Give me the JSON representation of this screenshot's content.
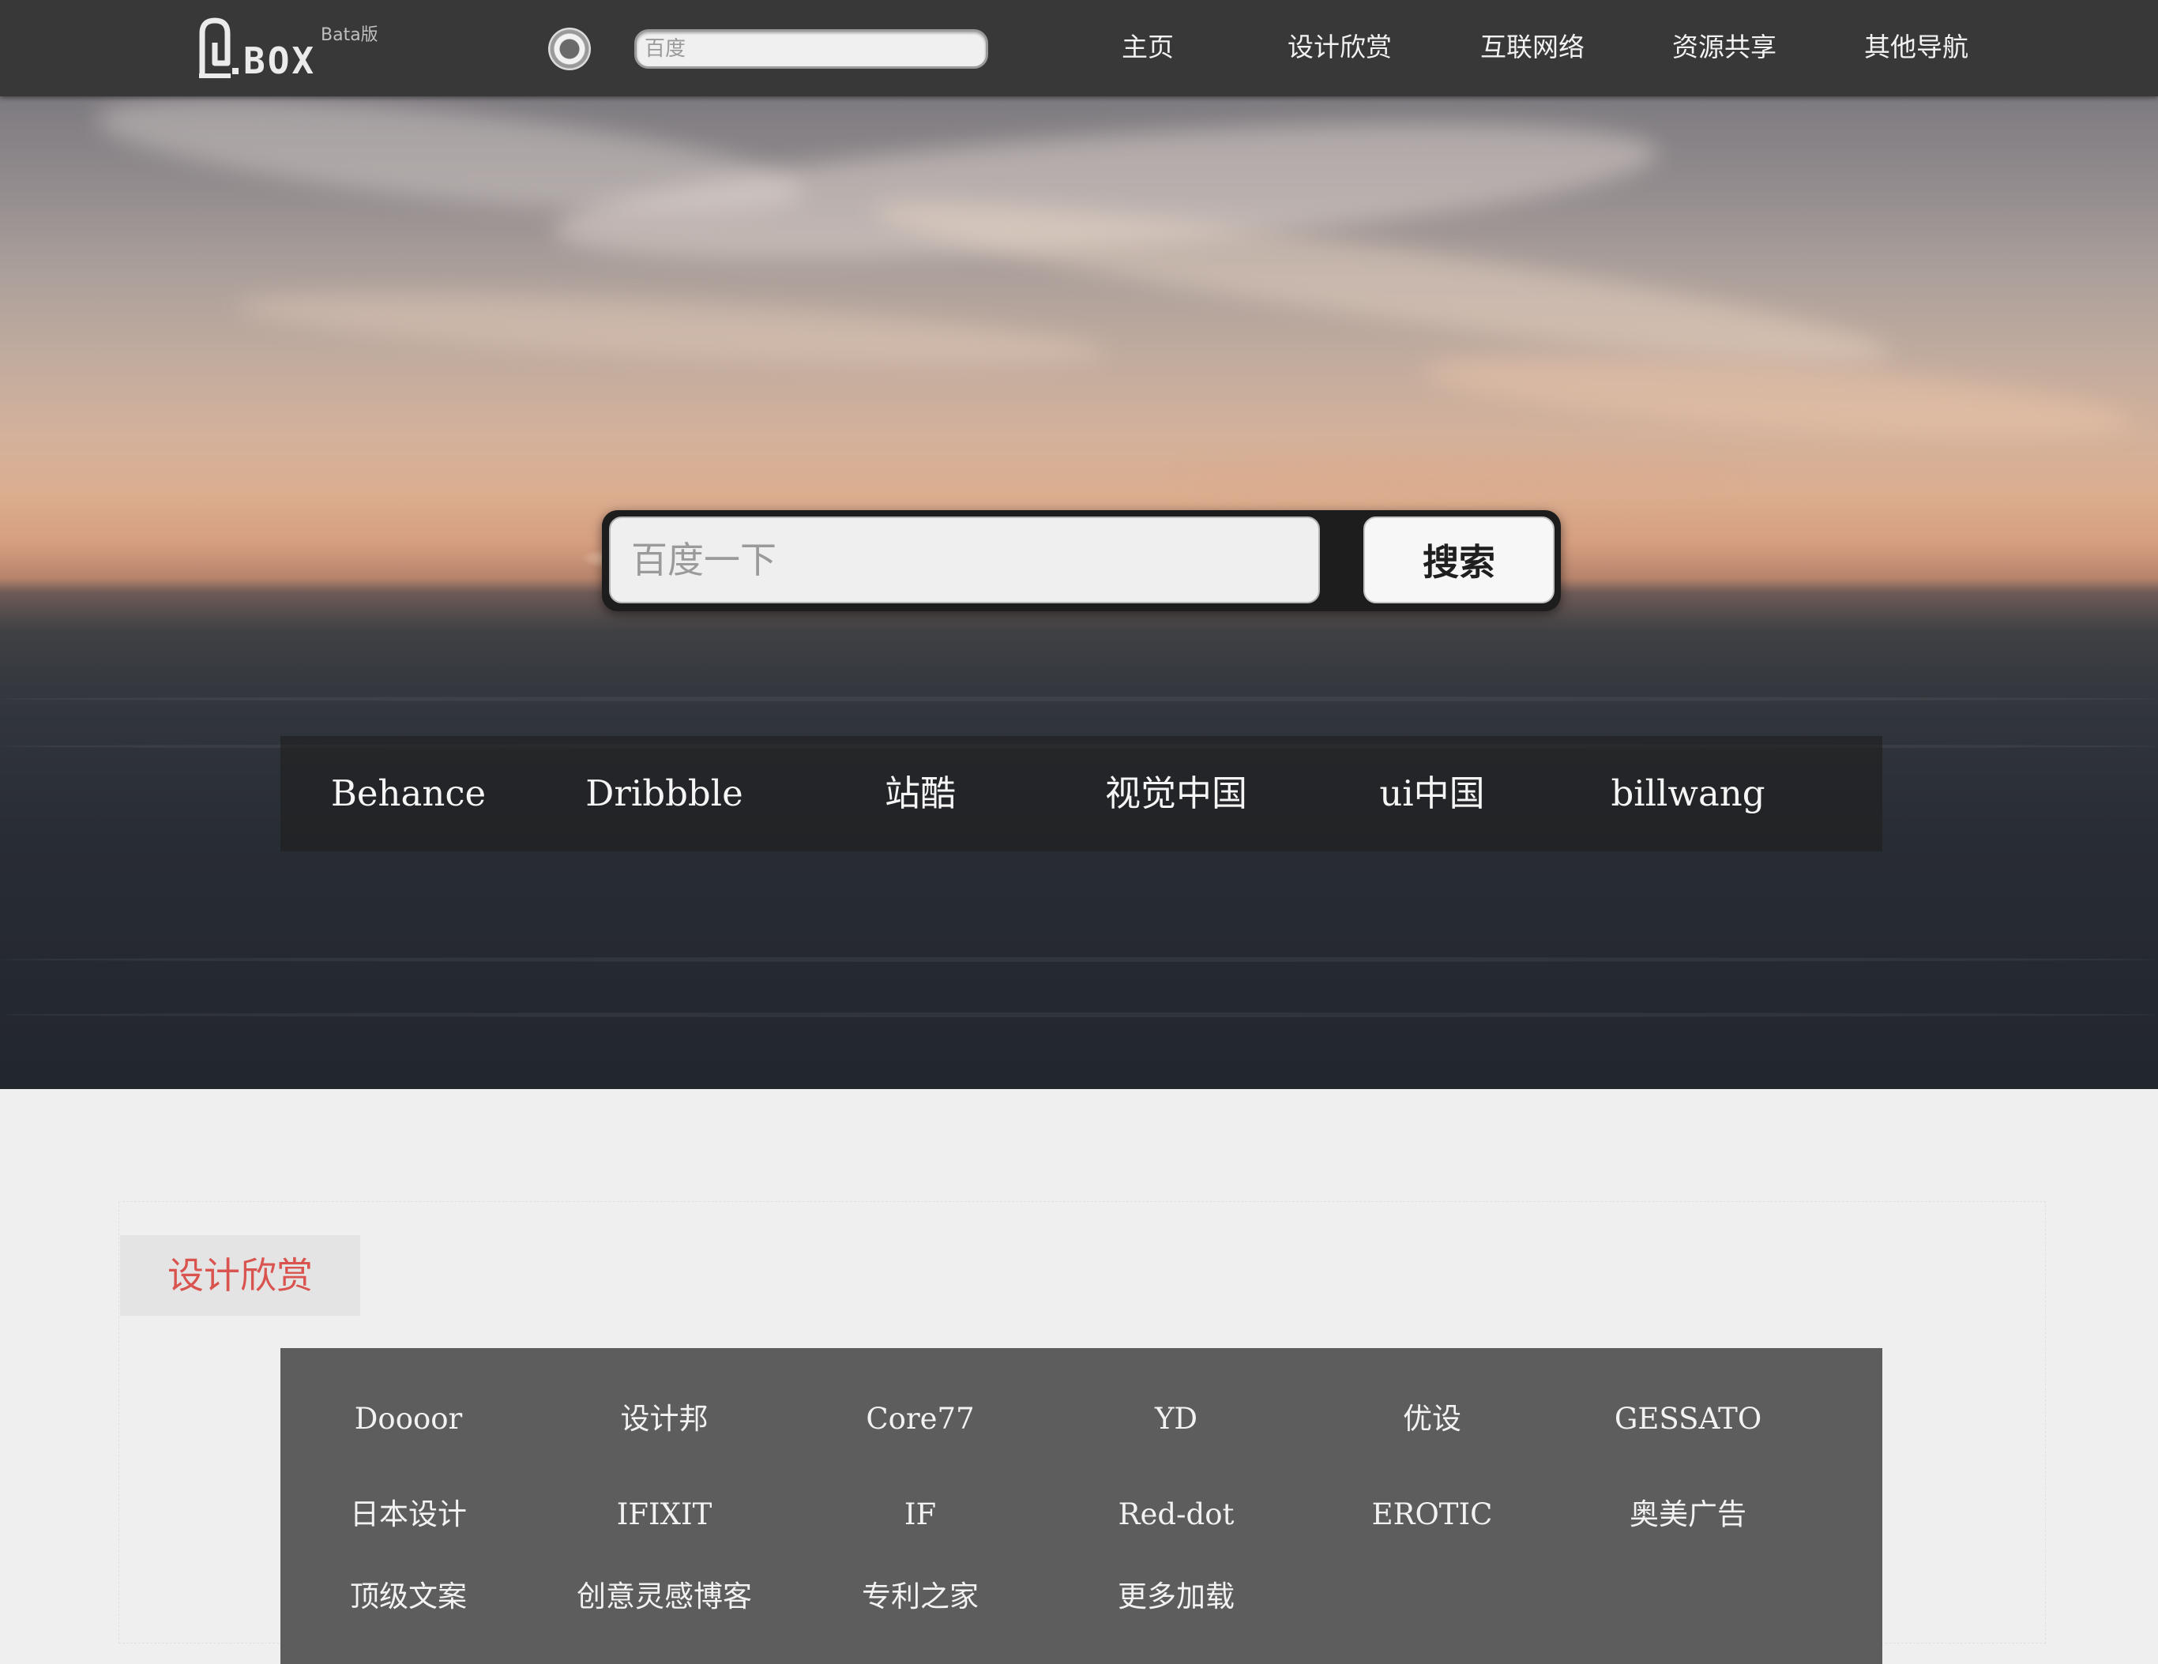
{
  "header": {
    "logo_text": "BOX",
    "logo_beta": "Bata版",
    "engine_icon": "radio-circle-icon",
    "search_placeholder": "百度",
    "nav": [
      {
        "label": "主页"
      },
      {
        "label": "设计欣赏"
      },
      {
        "label": "互联网络"
      },
      {
        "label": "资源共享"
      },
      {
        "label": "其他导航"
      }
    ]
  },
  "hero": {
    "search_placeholder": "百度一下",
    "search_button": "搜索",
    "quick_links": [
      "Behance",
      "Dribbble",
      "站酷",
      "视觉中国",
      "ui中国",
      "billwang"
    ]
  },
  "section": {
    "title": "设计欣赏",
    "links": [
      "Doooor",
      "设计邦",
      "Core77",
      "YD",
      "优设",
      "GESSATO",
      "日本设计",
      "IFIXIT",
      "IF",
      "Red-dot",
      "EROTIC",
      "奥美广告",
      "顶级文案",
      "创意灵感博客",
      "专利之家",
      "更多加载"
    ]
  },
  "colors": {
    "topbar": "#383838",
    "section_title": "#d9534f",
    "grid_bg": "#5d5d5d"
  }
}
